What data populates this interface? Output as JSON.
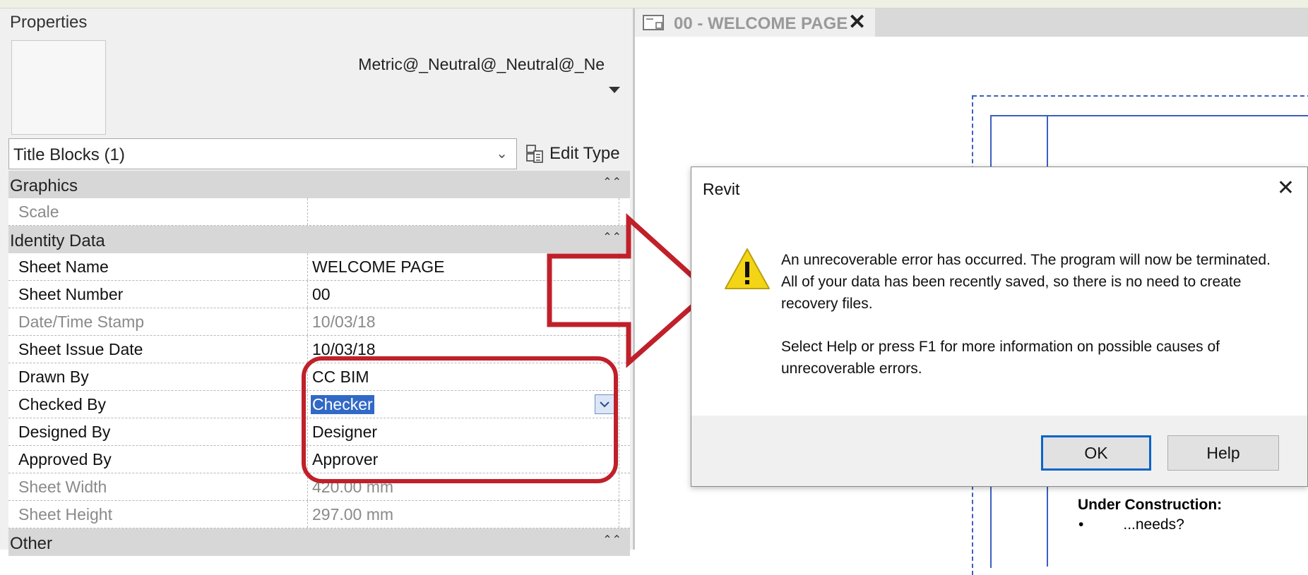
{
  "properties": {
    "title": "Properties",
    "type_name": "Metric@_Neutral@_Neutral@_Ne",
    "filter_label": "Title Blocks (1)",
    "edit_type_label": "Edit Type",
    "groups": [
      {
        "label": "Graphics",
        "rows": [
          {
            "name": "Scale",
            "value": ""
          }
        ]
      },
      {
        "label": "Identity Data",
        "rows": [
          {
            "name": "Sheet Name",
            "value": "WELCOME PAGE"
          },
          {
            "name": "Sheet Number",
            "value": "00"
          },
          {
            "name": "Date/Time Stamp",
            "value": "10/03/18"
          },
          {
            "name": "Sheet Issue Date",
            "value": "10/03/18"
          },
          {
            "name": "Drawn By",
            "value": "CC BIM"
          },
          {
            "name": "Checked By",
            "value": "Checker"
          },
          {
            "name": "Designed By",
            "value": "Designer"
          },
          {
            "name": "Approved By",
            "value": "Approver"
          },
          {
            "name": "Sheet Width",
            "value": "420.00 mm"
          },
          {
            "name": "Sheet Height",
            "value": "297.00 mm"
          }
        ]
      },
      {
        "label": "Other"
      }
    ]
  },
  "view": {
    "tab_label": "00 - WELCOME PAGE",
    "close_glyph": "✕",
    "drawing": {
      "heading": "Under Construction:",
      "bullet": "•",
      "item": "...needs?"
    }
  },
  "dialog": {
    "title": "Revit",
    "close_glyph": "✕",
    "message_1": "An unrecoverable error has occurred.  The program will now be terminated.  All of your data has been recently saved, so there is no need to create recovery files.",
    "message_2": "Select Help or press F1 for more information on possible causes of unrecoverable errors.",
    "ok_label": "OK",
    "help_label": "Help"
  },
  "colors": {
    "annotation_red": "#c0202a",
    "selection_blue": "#3169c6",
    "drawing_blue": "#3b5fc2",
    "warning_yellow": "#f3d516"
  }
}
